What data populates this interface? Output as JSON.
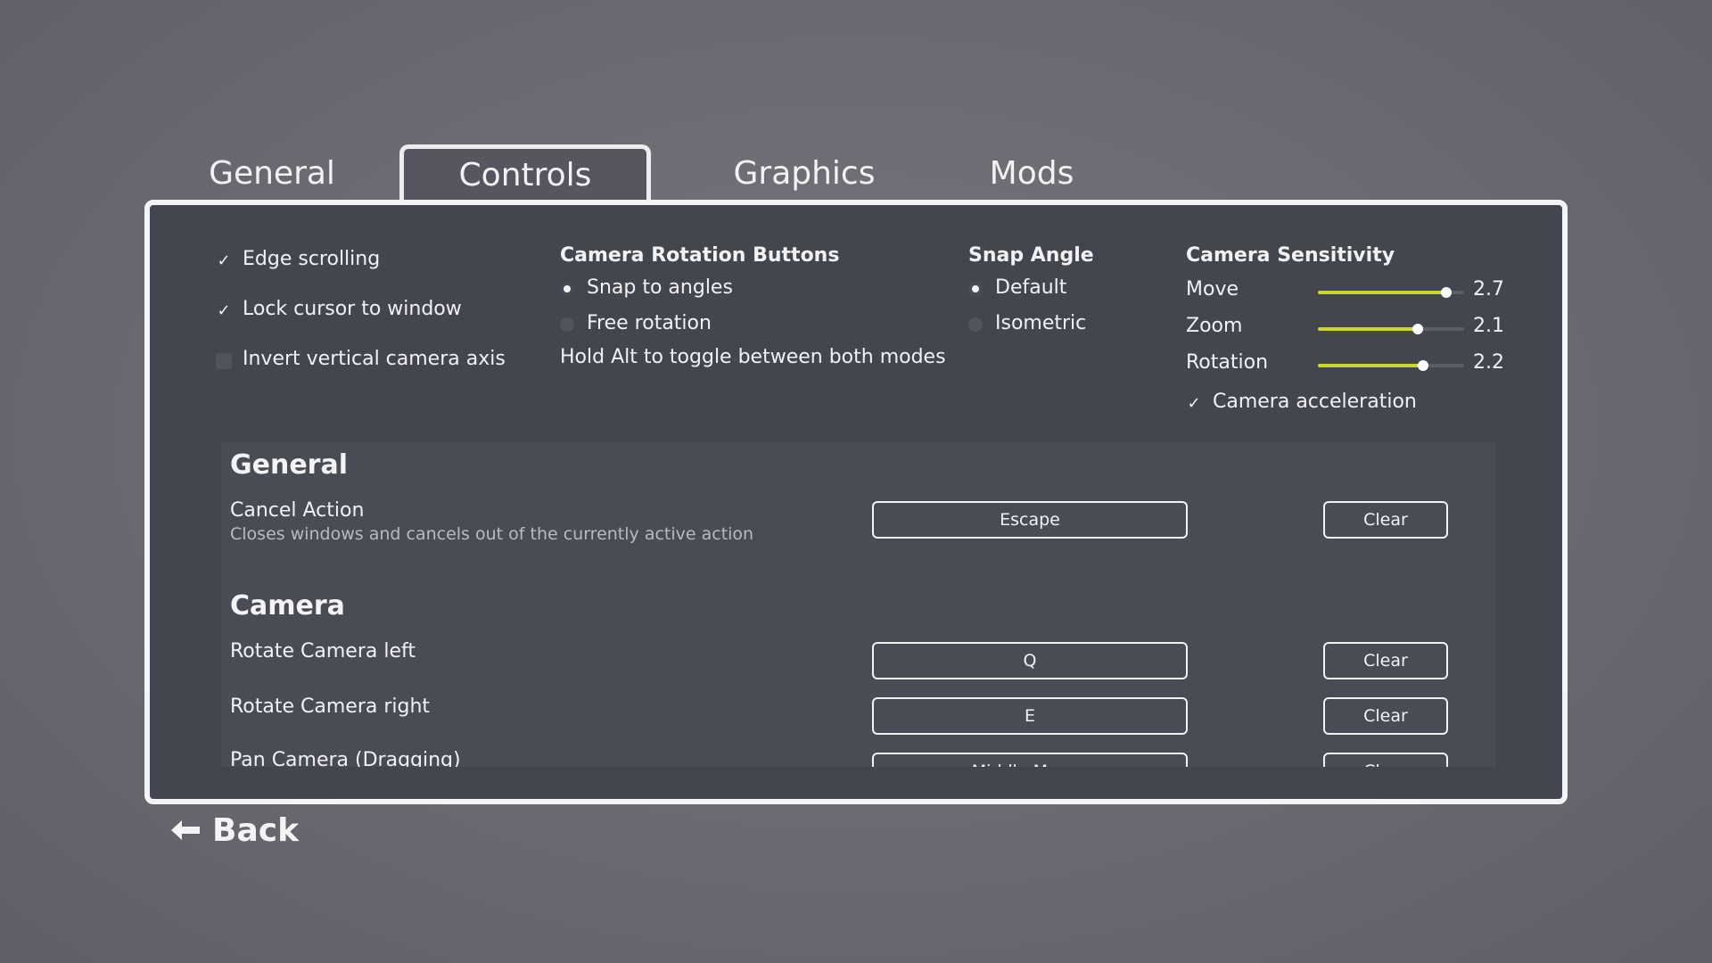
{
  "tabs": [
    {
      "label": "General"
    },
    {
      "label": "Controls"
    },
    {
      "label": "Graphics"
    },
    {
      "label": "Mods"
    }
  ],
  "active_tab": "Controls",
  "options": {
    "edge_scrolling": {
      "label": "Edge scrolling",
      "checked": true
    },
    "lock_cursor": {
      "label": "Lock cursor to window",
      "checked": true
    },
    "invert_vertical": {
      "label": "Invert vertical camera axis",
      "checked": false
    }
  },
  "camera_rotation": {
    "heading": "Camera Rotation Buttons",
    "options": [
      {
        "label": "Snap to angles",
        "selected": true
      },
      {
        "label": "Free rotation",
        "selected": false
      }
    ],
    "hint": "Hold Alt to toggle between both modes"
  },
  "snap_angle": {
    "heading": "Snap Angle",
    "options": [
      {
        "label": "Default",
        "selected": true
      },
      {
        "label": "Isometric",
        "selected": false
      }
    ]
  },
  "sensitivity": {
    "heading": "Camera Sensitivity",
    "sliders": [
      {
        "label": "Move",
        "value": "2.7",
        "fraction": 0.88
      },
      {
        "label": "Zoom",
        "value": "2.1",
        "fraction": 0.68
      },
      {
        "label": "Rotation",
        "value": "2.2",
        "fraction": 0.72
      }
    ],
    "acceleration": {
      "label": "Camera acceleration",
      "checked": true
    }
  },
  "keybinds": {
    "general_title": "General",
    "cancel": {
      "name": "Cancel Action",
      "desc": "Closes windows and cancels out of the currently active action",
      "key": "Escape",
      "clear": "Clear"
    },
    "camera_title": "Camera",
    "rotate_left": {
      "name": "Rotate Camera left",
      "key": "Q",
      "clear": "Clear"
    },
    "rotate_right": {
      "name": "Rotate Camera right",
      "key": "E",
      "clear": "Clear"
    },
    "pan": {
      "name": "Pan Camera (Dragging)",
      "key": "Middle Mouse",
      "clear": "Clear"
    }
  },
  "back": {
    "label": "Back"
  },
  "colors": {
    "accent": "#c9d828",
    "panel": "#43454f",
    "background": "#6b6b73"
  }
}
